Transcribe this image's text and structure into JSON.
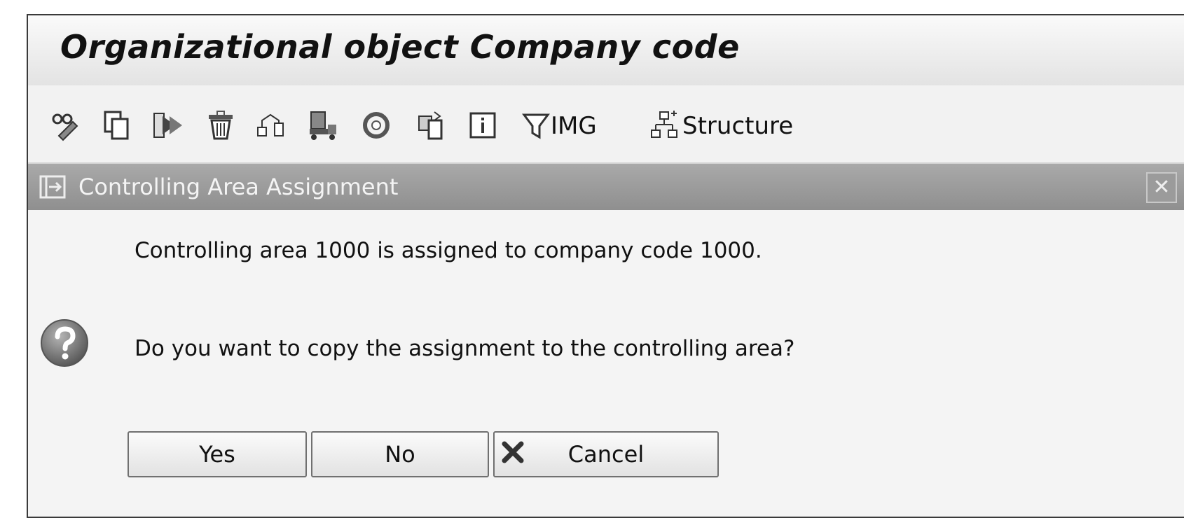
{
  "window": {
    "title": "Organizational object Company code"
  },
  "toolbar": {
    "icons": [
      {
        "name": "glasses-edit-icon"
      },
      {
        "name": "copy-icon"
      },
      {
        "name": "copy-as-icon"
      },
      {
        "name": "delete-icon"
      },
      {
        "name": "check-dependencies-icon"
      },
      {
        "name": "transport-icon"
      },
      {
        "name": "help-icon"
      },
      {
        "name": "export-icon"
      },
      {
        "name": "info-icon"
      }
    ],
    "img_label": "IMG",
    "structure_label": "Structure"
  },
  "dialog": {
    "title": "Controlling Area Assignment",
    "close_symbol": "✕",
    "message_line1": "Controlling area 1000 is assigned to company code 1000.",
    "message_line2": "Do you want to copy the assignment to the controlling area?",
    "buttons": {
      "yes": "Yes",
      "no": "No",
      "cancel": "Cancel"
    }
  },
  "colors": {
    "dialog_header": "#9e9e9e",
    "window_bg": "#f3f3f3",
    "button_border": "#707070"
  }
}
